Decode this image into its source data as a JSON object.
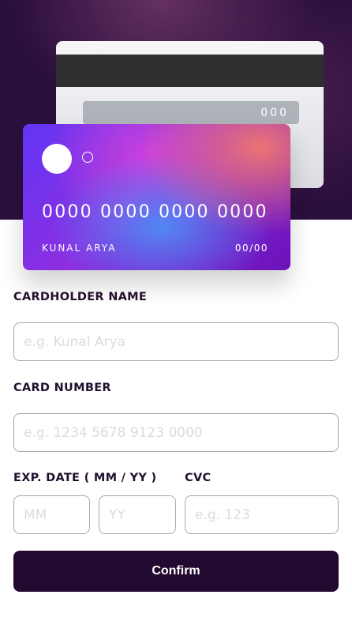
{
  "card_back": {
    "cvc": "000"
  },
  "card_front": {
    "number": "0000 0000 0000 0000",
    "holder": "KUNAL ARYA",
    "expiry": "00/00"
  },
  "form": {
    "cardholder_label": "CARDHOLDER NAME",
    "cardholder_placeholder": "e.g. Kunal Arya",
    "cardholder_value": "",
    "number_label": "CARD NUMBER",
    "number_placeholder": "e.g. 1234 5678 9123 0000",
    "number_value": "",
    "exp_label": "EXP. DATE ( MM / YY )",
    "mm_placeholder": "MM",
    "yy_placeholder": "YY",
    "cvc_label": "CVC",
    "cvc_placeholder": "e.g. 123",
    "confirm_label": "Confirm"
  },
  "colors": {
    "hero_background": "#2b0f3c",
    "button_background": "#22092f",
    "label_text": "#22102e",
    "input_border": "#a9a6ad"
  }
}
